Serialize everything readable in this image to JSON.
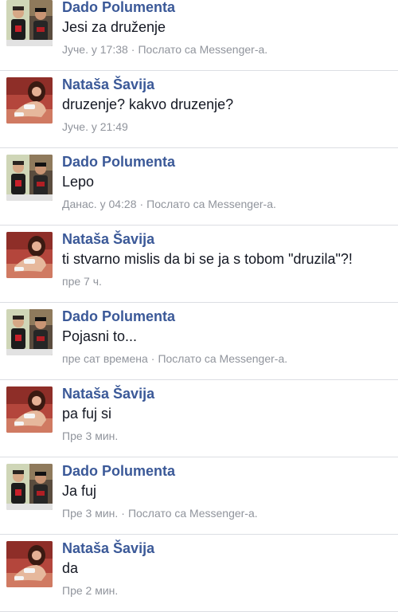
{
  "messages": [
    {
      "sender": "Dado Polumenta",
      "text": "Jesi za druženje",
      "time": "Јуче. у 17:38",
      "via": "Послато са Messenger-а.",
      "avatar": "male-avatar"
    },
    {
      "sender": "Nataša Šavija",
      "text": "druzenje? kakvo druzenje?",
      "time": "Јуче. у 21:49",
      "via": "",
      "avatar": "female-avatar"
    },
    {
      "sender": "Dado Polumenta",
      "text": "Lepo",
      "time": "Данас. у 04:28",
      "via": "Послато са Messenger-а.",
      "avatar": "male-avatar"
    },
    {
      "sender": "Nataša Šavija",
      "text": "ti stvarno mislis da bi se ja s tobom \"druzila\"?!",
      "time": "пре 7 ч.",
      "via": "",
      "avatar": "female-avatar"
    },
    {
      "sender": "Dado Polumenta",
      "text": "Pojasni to...",
      "time": "пре сат времена",
      "via": "Послато са Messenger-а.",
      "avatar": "male-avatar"
    },
    {
      "sender": "Nataša Šavija",
      "text": "pa fuj si",
      "time": "Пре 3 мин.",
      "via": "",
      "avatar": "female-avatar"
    },
    {
      "sender": "Dado Polumenta",
      "text": "Ja fuj",
      "time": "Пре 3 мин.",
      "via": "Послато са Messenger-а.",
      "avatar": "male-avatar"
    },
    {
      "sender": "Nataša Šavija",
      "text": "da",
      "time": "Пре 2 мин.",
      "via": "",
      "avatar": "female-avatar"
    }
  ],
  "separator": "·",
  "colors": {
    "sender": "#3b5998",
    "text": "#141823",
    "meta": "#90949c",
    "divider": "#dcdee3"
  }
}
